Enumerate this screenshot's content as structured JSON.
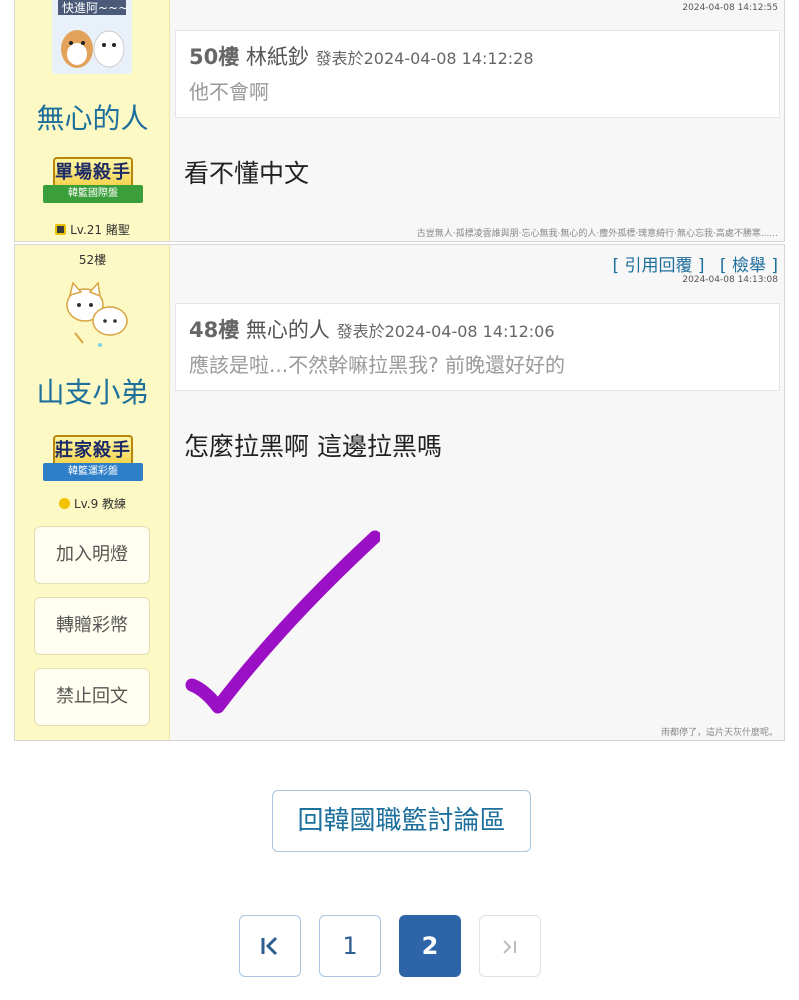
{
  "post1": {
    "timestamp": "2024-04-08 14:12:55",
    "avatar_text": "快進阿~~~",
    "username": "無心的人",
    "badge": {
      "title": "單場殺手",
      "subtitle": "韓籃國際盤"
    },
    "level": "Lv.21 賭聖",
    "quote": {
      "floor": "50樓",
      "author": "林紙鈔",
      "meta": "發表於2024-04-08 14:12:28",
      "text": "他不會啊"
    },
    "body": "看不懂中文",
    "signature": "古豈無人·孤標凌雲誰與朋·忘心無我·無心的人·塵外孤標·瑰意綺行·無心忘我·高處不勝寒......"
  },
  "post2": {
    "floor": "52樓",
    "quote_reply": "[ 引用回覆 ]",
    "report": "[ 檢舉 ]",
    "timestamp": "2024-04-08 14:13:08",
    "username": "山支小弟",
    "badge": {
      "title": "莊家殺手",
      "subtitle": "韓籃運彩盤"
    },
    "level": "Lv.9 教練",
    "buttons": [
      "加入明燈",
      "轉贈彩幣",
      "禁止回文"
    ],
    "quote": {
      "floor": "48樓",
      "author": "無心的人",
      "meta": "發表於2024-04-08 14:12:06",
      "text": "應該是啦...不然幹嘛拉黑我? 前晚還好好的"
    },
    "body": "怎麼拉黑啊 這邊拉黑嗎",
    "signature": "雨都停了，這片天灰什麼呢。"
  },
  "back_button": "回韓國職籃討論區",
  "pagination": {
    "first": "|<",
    "pages": [
      "1",
      "2"
    ],
    "current": "2",
    "last": ">|"
  },
  "colors": {
    "accent": "#1d6f9c",
    "sidebar": "#fdf9c4",
    "active_page": "#2e64a8",
    "checkmark": "#9b10c4"
  }
}
